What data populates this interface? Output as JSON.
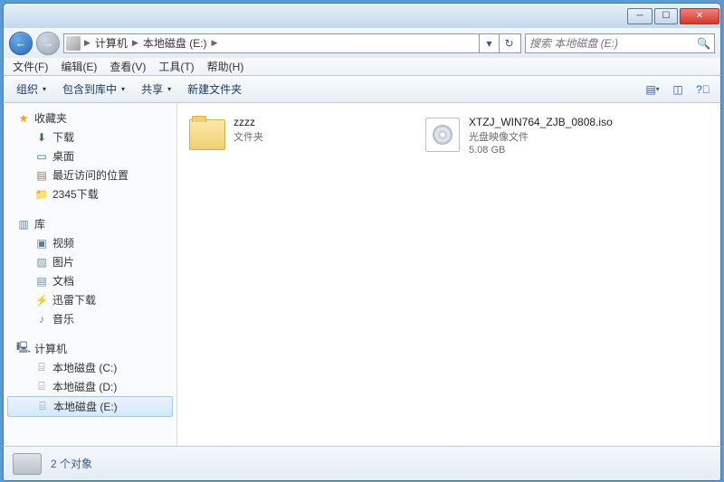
{
  "breadcrumb": {
    "root": "计算机",
    "current": "本地磁盘 (E:)"
  },
  "search": {
    "placeholder": "搜索 本地磁盘 (E:)"
  },
  "menu": {
    "file": "文件(F)",
    "edit": "编辑(E)",
    "view": "查看(V)",
    "tools": "工具(T)",
    "help": "帮助(H)"
  },
  "toolbar": {
    "organize": "组织",
    "include": "包含到库中",
    "share": "共享",
    "newfolder": "新建文件夹"
  },
  "sidebar": {
    "favorites": {
      "label": "收藏夹",
      "items": [
        "下载",
        "桌面",
        "最近访问的位置",
        "2345下载"
      ]
    },
    "libraries": {
      "label": "库",
      "items": [
        "视频",
        "图片",
        "文档",
        "迅雷下载",
        "音乐"
      ]
    },
    "computer": {
      "label": "计算机",
      "items": [
        "本地磁盘 (C:)",
        "本地磁盘 (D:)",
        "本地磁盘 (E:)"
      ]
    }
  },
  "files": [
    {
      "name": "zzzz",
      "type": "文件夹",
      "size": ""
    },
    {
      "name": "XTZJ_WIN764_ZJB_0808.iso",
      "type": "光盘映像文件",
      "size": "5.08 GB"
    }
  ],
  "status": {
    "text": "2 个对象"
  }
}
